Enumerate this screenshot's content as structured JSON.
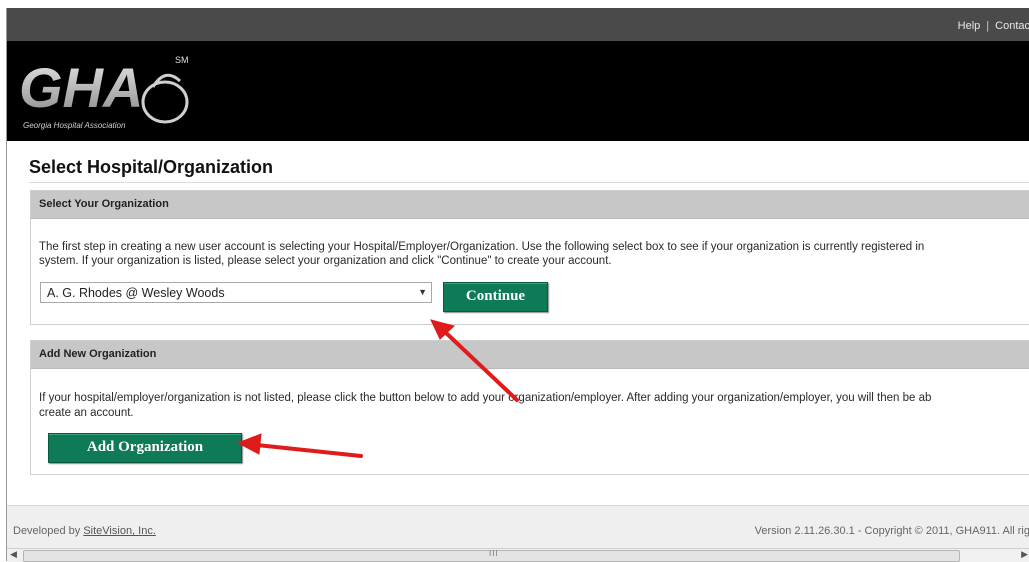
{
  "header": {
    "links": [
      "Help",
      "Contac"
    ],
    "separator": "|",
    "logo_text": "GHA",
    "logo_mark": "SM",
    "logo_subtitle": "Georgia Hospital Association"
  },
  "page": {
    "title": "Select Hospital/Organization"
  },
  "select_section": {
    "heading": "Select Your Organization",
    "text_line1": "The first step in creating a new user account is selecting your Hospital/Employer/Organization. Use the following select box to see if your organization is currently registered in",
    "text_line2": "system. If your organization is listed, please select your organization and click \"Continue\" to create your account.",
    "selected_org": "A. G. Rhodes @ Wesley Woods",
    "continue_label": "Continue"
  },
  "add_section": {
    "heading": "Add New Organization",
    "text_line1": "If your hospital/employer/organization is not listed, please click the button below to add your organization/employer. After adding your organization/employer, you will then be ab",
    "text_line2": "create an account.",
    "add_label": "Add Organization"
  },
  "footer": {
    "developed_by": "Developed by",
    "developer_link": "SiteVision, Inc.",
    "version_text": "Version 2.11.26.30.1 - Copyright © 2011, GHA911. All rig"
  },
  "scrollbar": {
    "grip": "III"
  },
  "colors": {
    "button_green": "#0f7a57",
    "annotation_arrow": "#e01b1b",
    "banner": "#000000",
    "topbar": "#4a4a4a",
    "section_header": "#c7c7c7"
  }
}
